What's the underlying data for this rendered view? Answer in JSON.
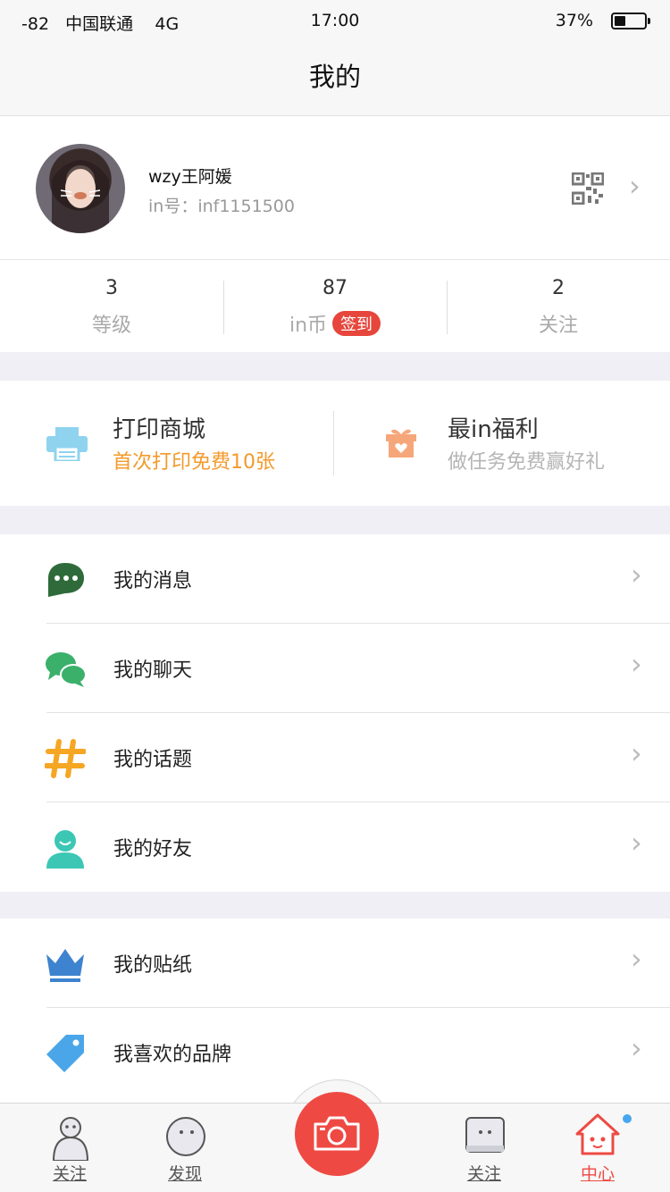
{
  "status_bar": {
    "signal": "-82",
    "carrier": "中国联通",
    "network": "4G",
    "time": "17:00",
    "battery": "37%",
    "battery_level": 0.37
  },
  "header": {
    "title": "我的"
  },
  "profile": {
    "name": "wzy王阿媛",
    "in_id": "in号：inf1151500",
    "qr_icon": "qr-code-icon",
    "arrow_icon": "chevron-right-icon"
  },
  "stats": [
    {
      "value": "3",
      "label": "等级"
    },
    {
      "value": "87",
      "label": "in币",
      "badge": "签到"
    },
    {
      "value": "2",
      "label": "关注"
    }
  ],
  "promo": {
    "left": {
      "title": "打印商城",
      "subtitle": "首次打印免费10张",
      "icon": "printer-icon",
      "subtitle_color": "#f39a2b"
    },
    "right": {
      "title": "最in福利",
      "subtitle": "做任务免费赢好礼",
      "icon": "gift-icon",
      "subtitle_color": "#b5b5b5"
    }
  },
  "menu_group1": [
    {
      "label": "我的消息",
      "icon": "message-icon",
      "color": "#2f6b3a"
    },
    {
      "label": "我的聊天",
      "icon": "chat-icon",
      "color": "#3bb06b"
    },
    {
      "label": "我的话题",
      "icon": "hashtag-icon",
      "color": "#f5a623"
    },
    {
      "label": "我的好友",
      "icon": "friend-icon",
      "color": "#3cc7b5"
    }
  ],
  "menu_group2": [
    {
      "label": "我的贴纸",
      "icon": "crown-icon",
      "color": "#3e83cf"
    },
    {
      "label": "我喜欢的品牌",
      "icon": "tag-icon",
      "color": "#4aa6e8"
    }
  ],
  "tab_bar": {
    "tabs": [
      {
        "label": "关注",
        "icon": "snowman-icon"
      },
      {
        "label": "发现",
        "icon": "face-icon"
      },
      {
        "label": "关注",
        "icon": "square-face-icon"
      },
      {
        "label": "中心",
        "icon": "house-face-icon",
        "active": true
      }
    ],
    "camera_icon": "camera-icon",
    "accent": "#ee4a43"
  }
}
